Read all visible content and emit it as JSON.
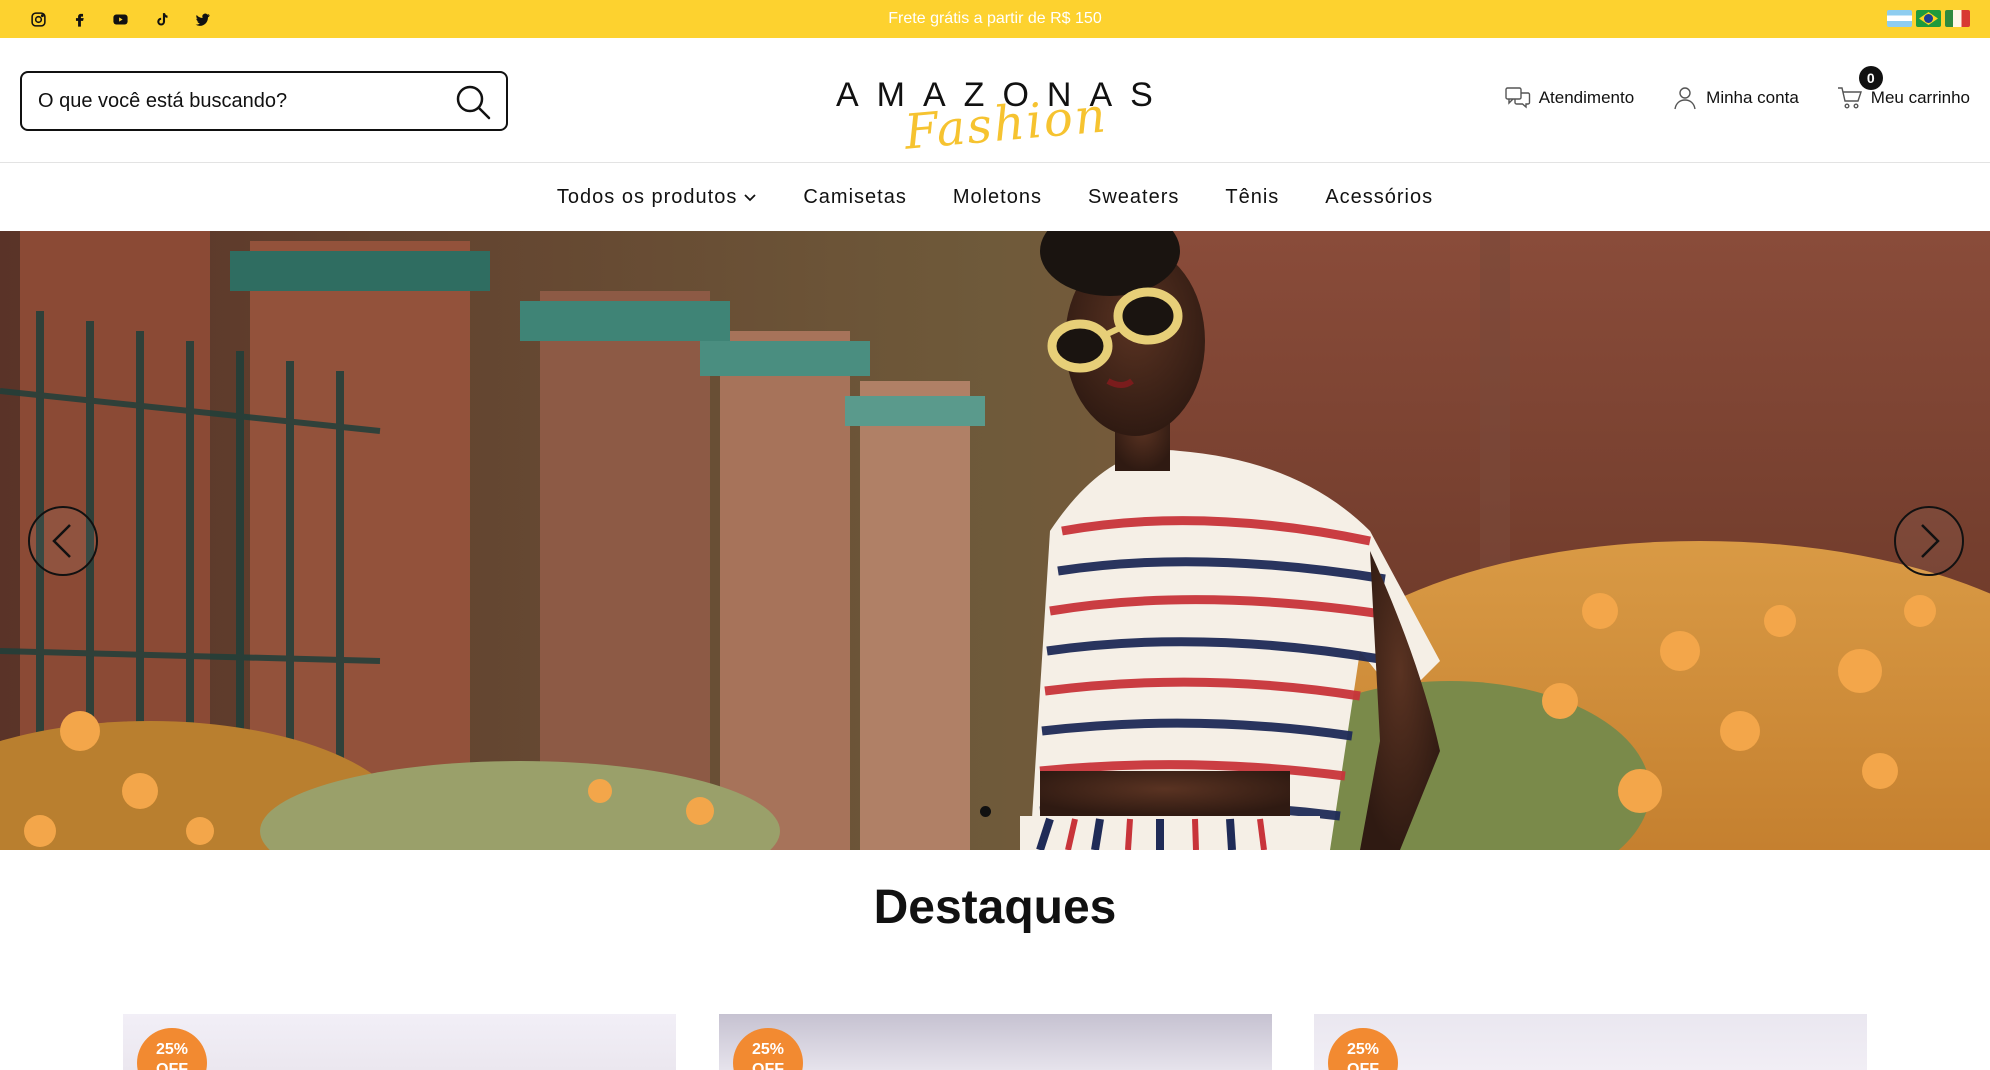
{
  "topbar": {
    "promo": "Frete grátis a partir de R$ 150",
    "socials": [
      "instagram-icon",
      "facebook-icon",
      "youtube-icon",
      "tiktok-icon",
      "twitter-icon"
    ],
    "flags": [
      "argentina-flag-icon",
      "brazil-flag-icon",
      "spain-flag-icon"
    ],
    "bg_color": "#fdd22f"
  },
  "header": {
    "search_placeholder": "O que você está buscando?",
    "logo_text": "AMAZONAS",
    "logo_script": "Fashion",
    "links": {
      "support": "Atendimento",
      "account": "Minha conta",
      "cart": "Meu carrinho",
      "cart_count": "0"
    }
  },
  "nav": {
    "items": [
      "Todos os produtos",
      "Camisetas",
      "Moletons",
      "Sweaters",
      "Tênis",
      "Acessórios"
    ]
  },
  "hero": {
    "slide_count": 1,
    "active_slide": 1
  },
  "featured": {
    "title": "Destaques",
    "products": [
      {
        "badge_line1": "25%",
        "badge_line2": "OFF"
      },
      {
        "badge_line1": "25%",
        "badge_line2": "OFF"
      },
      {
        "badge_line1": "25%",
        "badge_line2": "OFF"
      }
    ],
    "badge_color": "#f28a31"
  }
}
